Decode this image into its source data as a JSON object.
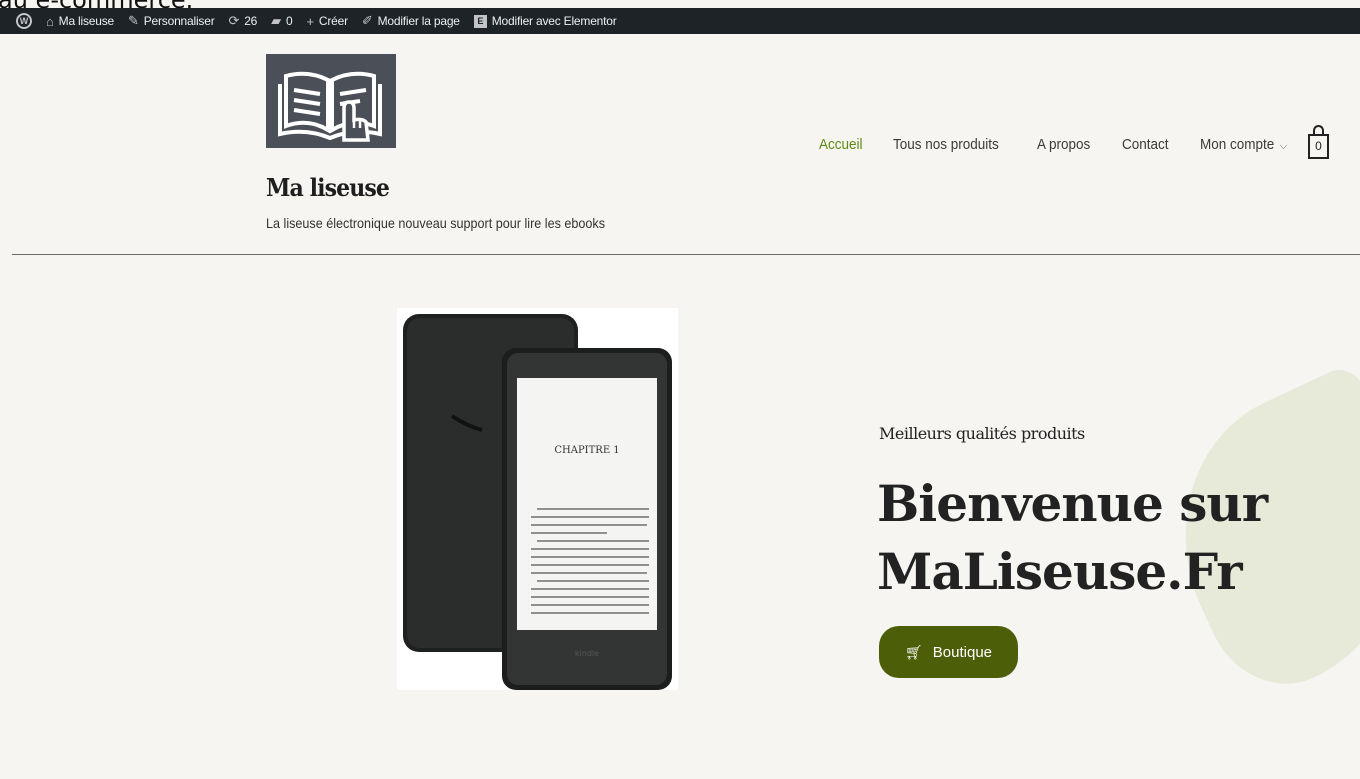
{
  "top_cut_text": "au e-commerce.",
  "admin_bar": {
    "site_name": "Ma liseuse",
    "customize": "Personnaliser",
    "updates": "26",
    "comments": "0",
    "new": "Créer",
    "edit_page": "Modifier la page",
    "edit_elementor": "Modifier avec Elementor"
  },
  "header": {
    "site_title": "Ma liseuse",
    "tagline": "La liseuse électronique nouveau support pour lire les ebooks",
    "nav": [
      "Accueil",
      "Tous nos produits",
      "A propos",
      "Contact",
      "Mon compte"
    ],
    "cart_count": "0"
  },
  "hero": {
    "eyebrow": "Meilleurs qualités produits",
    "title_line1": "Bienvenue sur",
    "title_line2": "MaLiseuse.Fr",
    "button": "Boutique",
    "ereader": {
      "chapter": "CHAPITRE 1",
      "brand": "kindle"
    }
  },
  "colors": {
    "accent": "#5d8a13",
    "button": "#4d5e08",
    "admin_bar": "#1d2327",
    "logo_bg": "#4b5058"
  }
}
